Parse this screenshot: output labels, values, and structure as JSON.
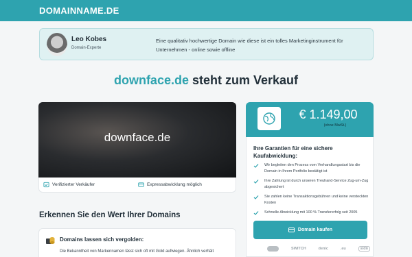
{
  "header": {
    "logo": "DOMAINNAME.DE"
  },
  "expert": {
    "name": "Leo Kobes",
    "role": "Domain-Experte",
    "text": "Eine qualitativ hochwertige Domain wie diese ist ein tolles Marketinginstrument für Unternehmen - online sowie offline"
  },
  "headline": {
    "domain": "downface.de",
    "suffix": " steht zum Verkauf"
  },
  "hero": {
    "domain": "downface.de"
  },
  "badges": {
    "verified": "Verifizierter Verkäufer",
    "express": "Expressabwicklung möglich"
  },
  "section": {
    "title": "Erkennen Sie den Wert Ihrer Domains"
  },
  "tip": {
    "title": "Domains lassen sich vergolden:",
    "text": "Die Bekanntheit von Markennamen lässt sich oft mit Gold aufwiegen. Ähnlich verhält"
  },
  "price": {
    "amount": "€ 1.149,00",
    "note": "(ohne MwSt.)"
  },
  "guarantee": {
    "title": "Ihre Garantien für eine sichere Kaufabwicklung:",
    "items": [
      "Wir begleiten den Prozess vom Verhandlungsstart bis die Domain in Ihrem Portfolio bestätigt ist",
      "Ihre Zahlung ist durch unseren Treuhand-Service Zug-um-Zug abgesichert",
      "Sie zahlen keine Transaktionsgebühren und keine versteckten Kosten",
      "Schnelle Abwicklung mit 100 % Transfererfolg seit 2005"
    ]
  },
  "buy": {
    "label": "Domain kaufen"
  },
  "payments": {
    "p1": "",
    "p2": "SWITCH",
    "p3": "denic",
    "p4": ".eu",
    "p5": "sidn"
  },
  "colors": {
    "accent": "#2ea3af",
    "check": "#2ea3af"
  }
}
